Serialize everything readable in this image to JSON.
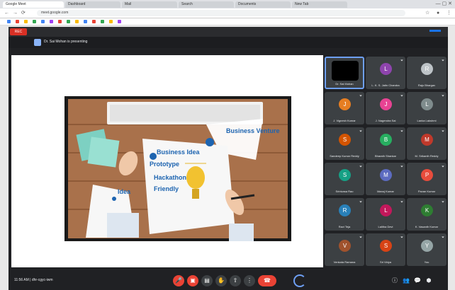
{
  "browser": {
    "tabs": [
      {
        "label": "Google Meet"
      },
      {
        "label": "Dashboard"
      },
      {
        "label": "Mail"
      },
      {
        "label": "Search"
      },
      {
        "label": "Documents"
      },
      {
        "label": "New Tab"
      }
    ],
    "address": "meet.google.com"
  },
  "meet": {
    "rec_label": "REC",
    "presenter": "Dr. Sai Mohan is presenting",
    "slide": {
      "texts": [
        "Business Venture",
        "Business Idea",
        "Prototype",
        "Hackathon",
        "Friendly",
        "Idea"
      ]
    },
    "participants": [
      {
        "name": "Dr. Sai Mohan",
        "initial": "",
        "color": "#000000",
        "self": true
      },
      {
        "name": "L. K. S. Jatin Chandra",
        "initial": "L",
        "color": "#8e44ad"
      },
      {
        "name": "Raju Bhargav",
        "initial": "R",
        "color": "#bdc3c7"
      },
      {
        "name": "J. Vignesh Kumar",
        "initial": "J",
        "color": "#e67e22"
      },
      {
        "name": "J. Nagendra Sai",
        "initial": "J",
        "color": "#e84393"
      },
      {
        "name": "Lanka Lakshmi",
        "initial": "L",
        "color": "#7f8c8d"
      },
      {
        "name": "Sandeep Kumar Reddy",
        "initial": "S",
        "color": "#d35400"
      },
      {
        "name": "Bharath Shankar",
        "initial": "B",
        "color": "#27ae60"
      },
      {
        "name": "M. Srikanth Reddy",
        "initial": "M",
        "color": "#c0392b"
      },
      {
        "name": "Srinivasa Rao",
        "initial": "S",
        "color": "#16a085"
      },
      {
        "name": "Manoj Kumar",
        "initial": "M",
        "color": "#5c6bc0"
      },
      {
        "name": "Pavan Kumar",
        "initial": "P",
        "color": "#e74c3c"
      },
      {
        "name": "Ravi Teja",
        "initial": "R",
        "color": "#2980b9"
      },
      {
        "name": "Lalitha Devi",
        "initial": "L",
        "color": "#c2185b"
      },
      {
        "name": "K. Vasanth Kumar",
        "initial": "K",
        "color": "#2e7d32"
      },
      {
        "name": "Venkata Ramana",
        "initial": "V",
        "color": "#a0522d"
      },
      {
        "name": "Sri Vidya",
        "initial": "S",
        "color": "#d84315"
      },
      {
        "name": "You",
        "initial": "Y",
        "color": "#95a5a6"
      }
    ],
    "clock": "11:56 AM | dhr-cgyc-iwm",
    "controls": [
      "mic",
      "camera",
      "captions",
      "raise hand",
      "present",
      "more",
      "leave"
    ],
    "right_controls": [
      "info",
      "people",
      "chat",
      "activities"
    ],
    "colors": {
      "accent": "#6ea0f5",
      "leave": "#ea4335",
      "background": "#202124"
    }
  }
}
